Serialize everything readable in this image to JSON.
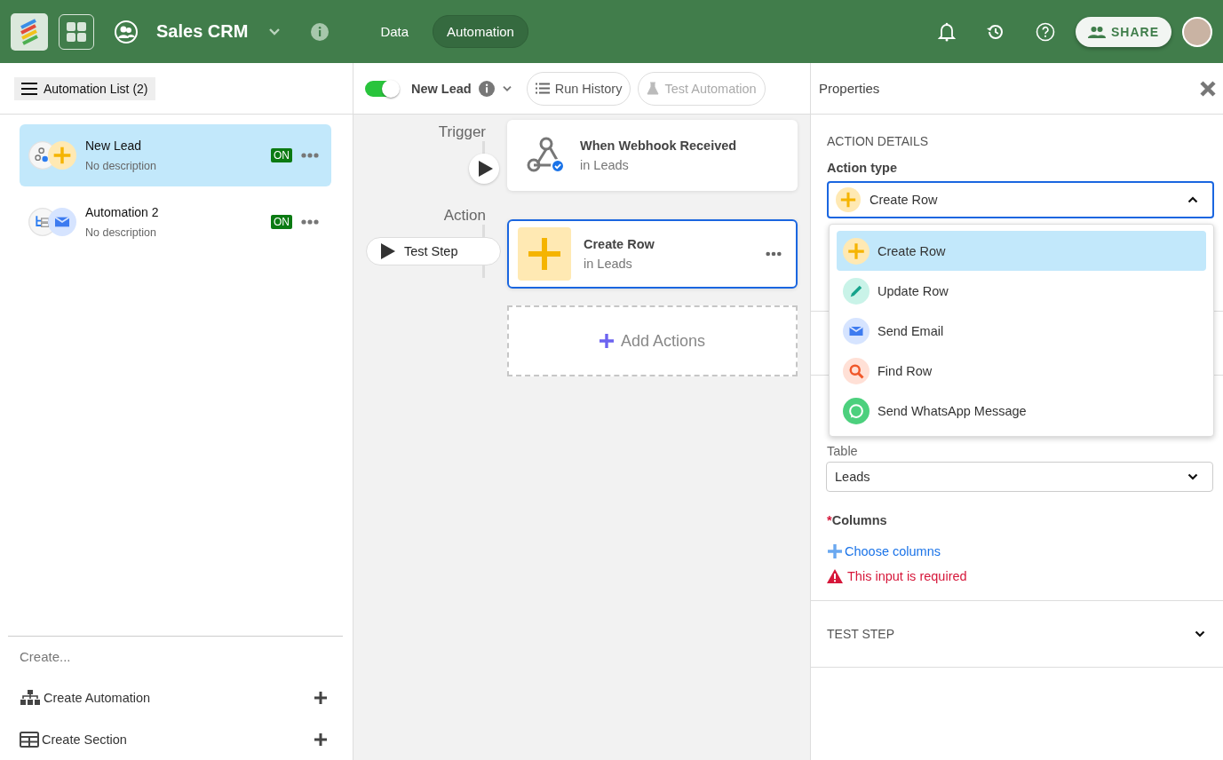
{
  "app": {
    "title": "Sales CRM",
    "nav": [
      {
        "label": "Data",
        "selected": false
      },
      {
        "label": "Automation",
        "selected": true
      }
    ],
    "share_label": "SHARE"
  },
  "sidebar": {
    "list_button": "Automation List (2)",
    "automations": [
      {
        "name": "New Lead",
        "description": "No description",
        "status": "ON",
        "selected": true,
        "trigger_icon": {
          "kind": "webhook"
        },
        "action_icon": {
          "kind": "create"
        }
      },
      {
        "name": "Automation 2",
        "description": "No description",
        "status": "ON",
        "selected": false,
        "trigger_icon": {
          "kind": "flow"
        },
        "action_icon": {
          "kind": "email"
        }
      }
    ],
    "create_heading": "Create...",
    "create_items": [
      {
        "label": "Create Automation",
        "kind": "automation"
      },
      {
        "label": "Create Section",
        "kind": "section"
      }
    ]
  },
  "toolbar": {
    "enabled": true,
    "name": "New Lead",
    "run_history": "Run History",
    "test_automation": {
      "label": "Test Automation",
      "disabled": true
    }
  },
  "flow": {
    "trigger_label": "Trigger",
    "action_label": "Action",
    "test_step": "Test Step",
    "trigger": {
      "title": "When Webhook Received",
      "subtitle": "in Leads"
    },
    "action": {
      "title": "Create Row",
      "subtitle": "in Leads",
      "kind": "create",
      "selected": true
    },
    "add_actions": "Add Actions"
  },
  "properties": {
    "title": "Properties",
    "section_heading": "ACTION DETAILS",
    "action_type_label": "Action type",
    "action_type": {
      "label": "Create Row",
      "kind": "create"
    },
    "dropdown_open": true,
    "options": [
      {
        "label": "Create Row",
        "kind": "create",
        "selected": true
      },
      {
        "label": "Update Row",
        "kind": "update",
        "selected": false
      },
      {
        "label": "Send Email",
        "kind": "email",
        "selected": false
      },
      {
        "label": "Find Row",
        "kind": "find",
        "selected": false
      },
      {
        "label": "Send WhatsApp Message",
        "kind": "whatsapp",
        "selected": false
      }
    ],
    "table_label": "Table",
    "table_value": "Leads",
    "required_mark": "*",
    "columns_label": "Columns",
    "choose_columns": "Choose columns",
    "error": "This input is required",
    "test_step_heading": "TEST STEP"
  }
}
